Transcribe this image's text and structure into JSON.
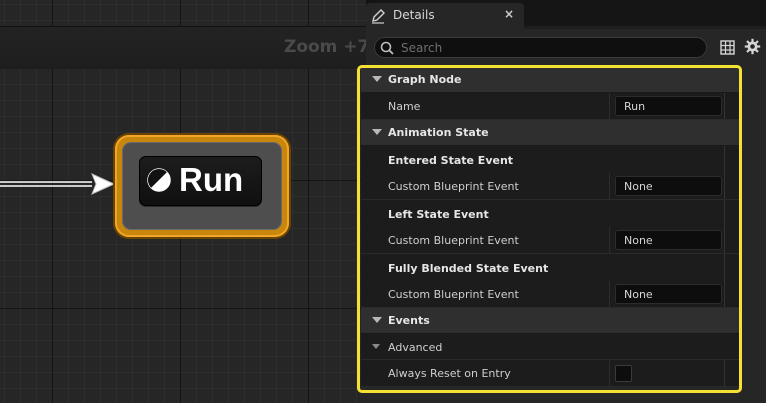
{
  "graph": {
    "zoom_label": "Zoom +7",
    "node": {
      "title": "Run"
    }
  },
  "details": {
    "tab_label": "Details",
    "tab_close": "×",
    "search": {
      "placeholder": "Search",
      "value": ""
    },
    "sections": {
      "graph_node": {
        "label": "Graph Node",
        "name_label": "Name",
        "name_value": "Run"
      },
      "animation_state": {
        "label": "Animation State",
        "entered_group": "Entered State Event",
        "entered_event_label": "Custom Blueprint Event",
        "entered_event_value": "None",
        "left_group": "Left State Event",
        "left_event_label": "Custom Blueprint Event",
        "left_event_value": "None",
        "blended_group": "Fully Blended State Event",
        "blended_event_label": "Custom Blueprint Event",
        "blended_event_value": "None"
      },
      "events": {
        "label": "Events",
        "advanced_label": "Advanced",
        "always_reset_label": "Always Reset on Entry",
        "always_reset_checked": false
      }
    }
  },
  "colors": {
    "node_border": "#c8860c",
    "highlight": "#f4e132",
    "background": "#262626"
  }
}
